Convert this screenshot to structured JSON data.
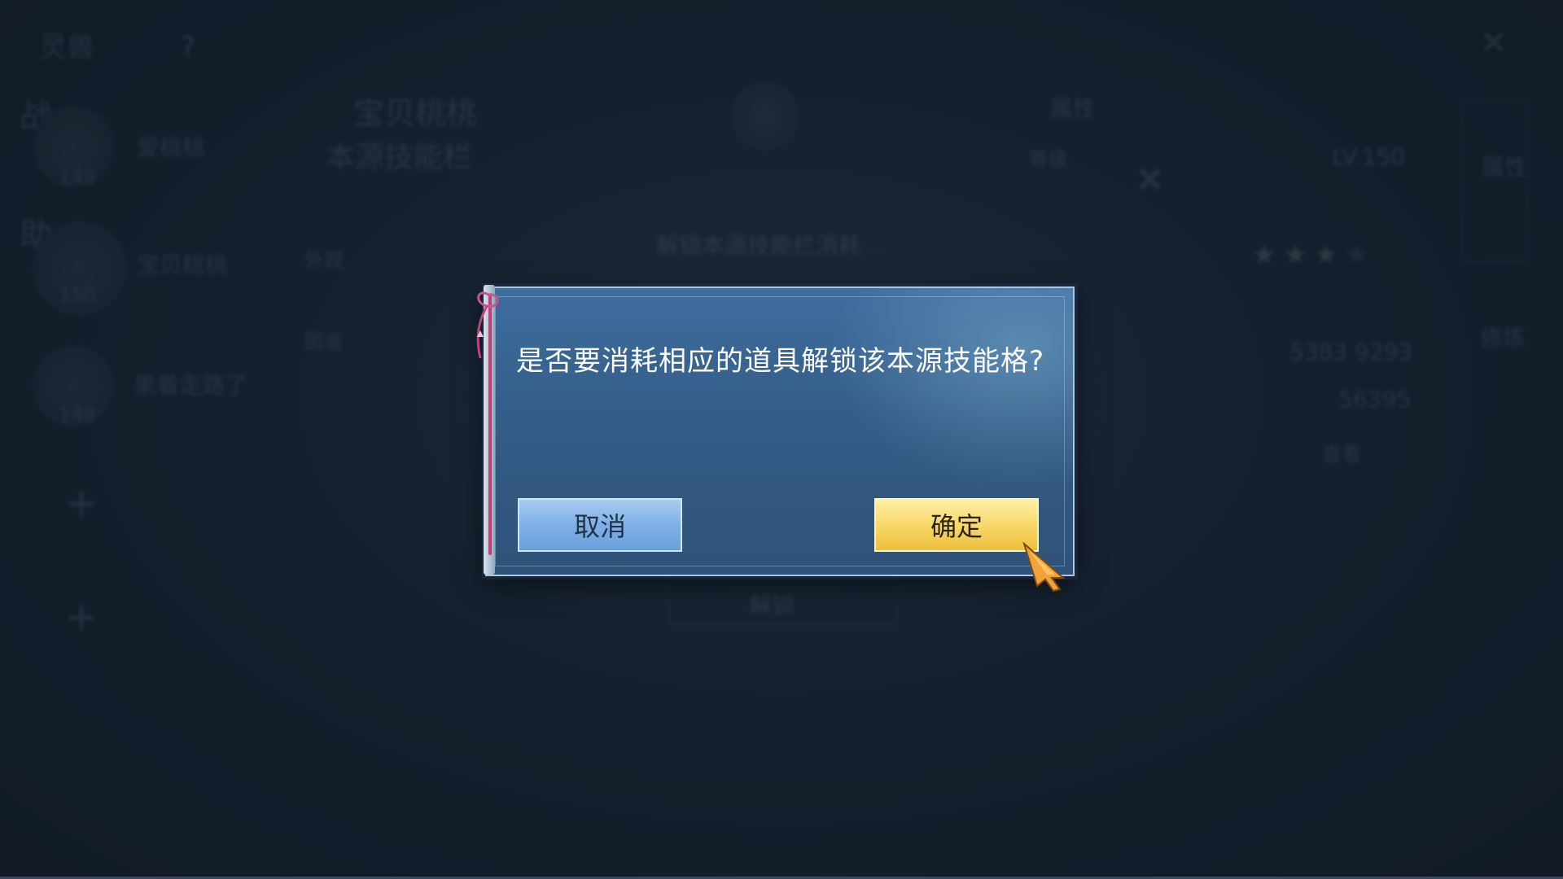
{
  "background": {
    "title": "灵兽",
    "pet_name": "宝贝桃桃",
    "skill_section": "本源技能栏",
    "unlock_cost_title": "解锁本源技能栏消耗",
    "tab_attributes": "属性",
    "tab_level_label": "等级",
    "level_value": "LV.150",
    "pets": [
      {
        "name": "爱桃桃",
        "level": "149"
      },
      {
        "name": "宝贝桃桃",
        "level": "150"
      },
      {
        "name": "果着走路了",
        "level": "148"
      }
    ],
    "side_tabs": [
      "战",
      "助"
    ],
    "menu_items": [
      "外观",
      "图鉴"
    ],
    "stat_values": [
      "5383 9293",
      "56395"
    ],
    "view_label": "查看",
    "unlock_button": "解锁",
    "right_tabs": [
      "属性",
      "修炼"
    ]
  },
  "dialog": {
    "message": "是否要消耗相应的道具解锁该本源技能格?",
    "cancel_label": "取消",
    "confirm_label": "确定"
  },
  "colors": {
    "dialog_bg": "#345d88",
    "cancel_button": "#7eb0e6",
    "confirm_button": "#f7d86a",
    "ribbon": "#c0407a"
  }
}
